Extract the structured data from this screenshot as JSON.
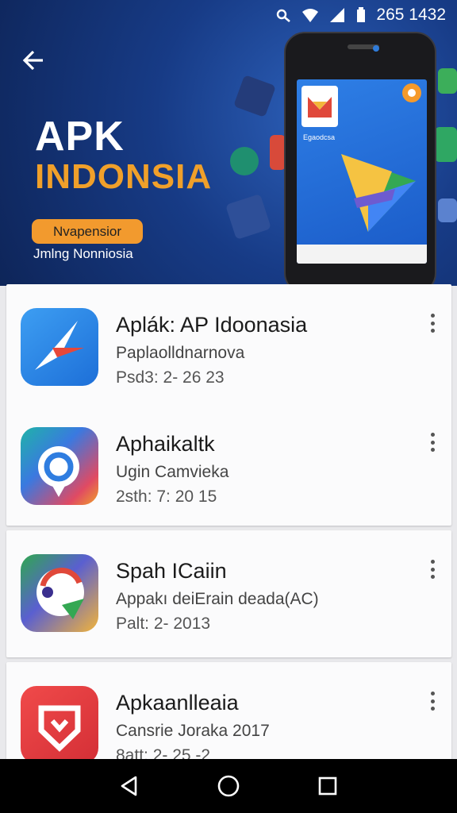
{
  "status_bar": {
    "time": "265 1432"
  },
  "banner": {
    "title_line1": "APK",
    "title_line2": "INDONSIA",
    "pill_label": "Nvapensior",
    "subtitle": "Jmlng Nonniosia",
    "phone_screen_label": "Egaodcsa"
  },
  "apps": [
    {
      "name": "Aplák: AP Idoonasia",
      "developer": "Paplaolldnarnova",
      "date": "Psd3: 2- 26 23"
    },
    {
      "name": "Aphaikaltk",
      "developer": "Ugin Camvieka",
      "date": "2sth: 7: 20 15"
    },
    {
      "name": "Spah ICaiin",
      "developer": "Appakı deiErain deada(AC)",
      "date": "Palt: 2- 2013"
    },
    {
      "name": "Apkaanlleaia",
      "developer": "Cansrie Joraka 2017",
      "date": "8att: 2- 25 -2"
    }
  ],
  "colors": {
    "banner_dark": "#0e2559",
    "banner_mid": "#1a5ac7",
    "accent_orange": "#f29a2e",
    "title_orange": "#f0a02a"
  }
}
